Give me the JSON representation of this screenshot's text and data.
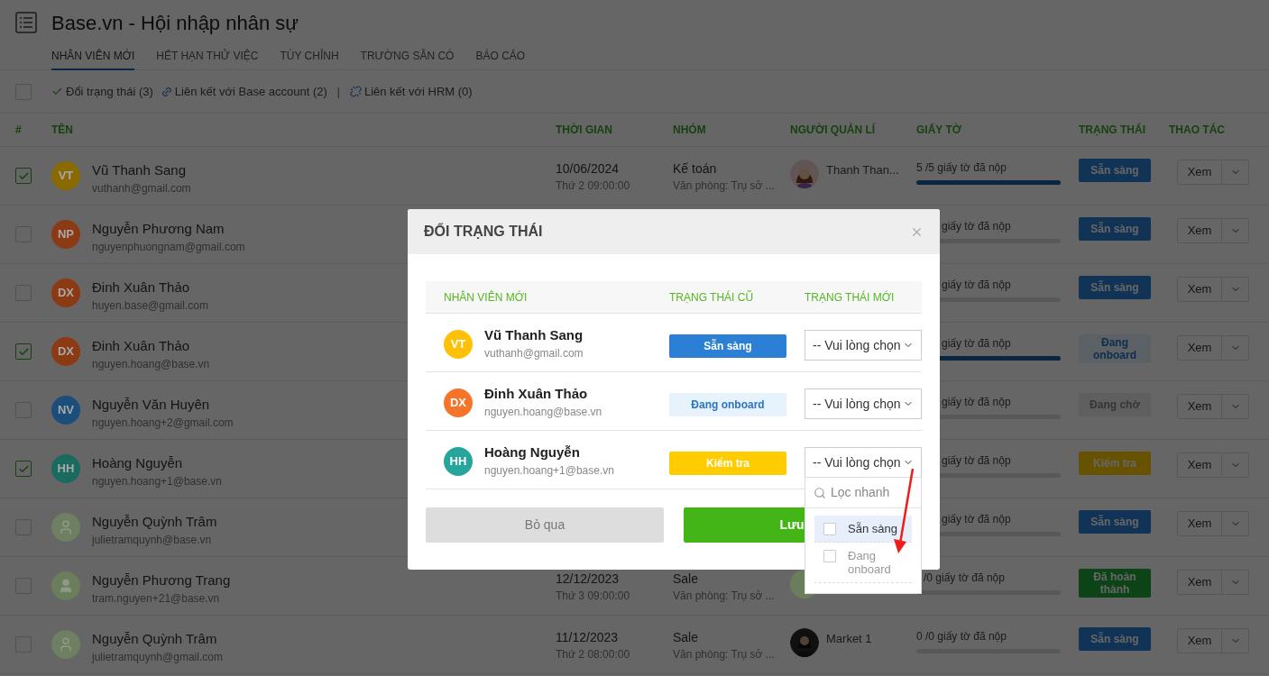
{
  "app": {
    "title": "Base.vn - Hội nhập nhân sự"
  },
  "tabs": [
    {
      "label": "NHÂN VIÊN MỚI",
      "selected": true
    },
    {
      "label": "HẾT HẠN THỬ VIỆC",
      "selected": false
    },
    {
      "label": "TÙY CHỈNH",
      "selected": false
    },
    {
      "label": "TRƯỜNG SẴN CÓ",
      "selected": false
    },
    {
      "label": "BÁO CÁO",
      "selected": false
    }
  ],
  "toolbar": {
    "select_all_checked": false,
    "actions": [
      {
        "kind": "check",
        "label": "Đổi trạng thái (3)"
      },
      {
        "kind": "link",
        "label": "Liên kết với Base account (2)"
      },
      {
        "kind": "separator",
        "label": "|"
      },
      {
        "kind": "unlink",
        "label": "Liên kết với HRM (0)"
      }
    ]
  },
  "table": {
    "columns": [
      "#",
      "TÊN",
      "THỜI GIAN",
      "NHÓM",
      "NGƯỜI QUẢN LÍ",
      "GIẤY TỜ",
      "TRẠNG THÁI",
      "THAO TÁC"
    ],
    "rows": [
      {
        "kind": "full",
        "checked": true,
        "avatar": {
          "kind": "initials",
          "initials": "VT",
          "color": "#8a6a00"
        },
        "name": "Vũ Thanh Sang",
        "email": "vuthanh@gmail.com",
        "date": "10/06/2024",
        "time": "Thứ 2 09:00:00",
        "group": "Kế toán",
        "office": "Văn phòng: Trụ sở ...",
        "manager": {
          "kind": "illustration",
          "name": "Thanh Than..."
        },
        "docs": "5 /5 giấy tờ đã nộp",
        "level": 1,
        "status": {
          "kind": "ready",
          "label": "Sẵn sàng"
        },
        "action": "Xem"
      },
      {
        "kind": "modal_covered",
        "checked": false,
        "avatar": {
          "kind": "initials",
          "initials": "NP",
          "color": "#8b3a14"
        },
        "name": "Nguyễn Phương Nam",
        "email": "nguyenphuongnam@gmail.com",
        "docs": "giấy tờ đã nộp",
        "level": 0,
        "status": {
          "kind": "ready",
          "label": "Sẵn sàng"
        },
        "action": "Xem"
      },
      {
        "kind": "modal_covered",
        "checked": false,
        "avatar": {
          "kind": "initials",
          "initials": "DX",
          "color": "#8b3a14"
        },
        "name": "Đinh Xuân Thảo",
        "email": "huyen.base@gmail.com",
        "docs": "giấy tờ đã nộp",
        "level": 0,
        "status": {
          "kind": "ready",
          "label": "Sẵn sàng"
        },
        "action": "Xem"
      },
      {
        "kind": "modal_covered",
        "checked": true,
        "avatar": {
          "kind": "initials",
          "initials": "DX",
          "color": "#8b3a14"
        },
        "name": "Đinh Xuân Thảo",
        "email": "nguyen.hoang@base.vn",
        "docs": "giấy tờ đã nộp",
        "level": 1,
        "status": {
          "kind": "onboarding",
          "label": "Đang onboard"
        },
        "action": "Xem"
      },
      {
        "kind": "modal_covered",
        "checked": false,
        "avatar": {
          "kind": "initials",
          "initials": "NV",
          "color": "#1b4e7a"
        },
        "name": "Nguyễn Văn Huyên",
        "email": "nguyen.hoang+2@gmail.com",
        "docs": "giấy tờ đã nộp",
        "level": 0,
        "status": {
          "kind": "waiting",
          "label": "Đang chờ"
        },
        "action": "Xem"
      },
      {
        "kind": "modal_covered",
        "checked": true,
        "avatar": {
          "kind": "initials",
          "initials": "HH",
          "color": "#1a6a5f"
        },
        "name": "Hoàng Nguyễn",
        "email": "nguyen.hoang+1@base.vn",
        "docs": "giấy tờ đã nộp",
        "level": 0,
        "status": {
          "kind": "checking",
          "label": "Kiểm tra"
        },
        "action": "Xem"
      },
      {
        "kind": "modal_covered",
        "checked": false,
        "avatar": {
          "kind": "outline",
          "color": "#6f7f62"
        },
        "name": "Nguyễn Quỳnh Trâm",
        "email": "julietramquynh@base.vn",
        "docs": "giấy tờ đã nộp",
        "level": 0,
        "status": {
          "kind": "ready",
          "label": "Sẵn sàng"
        },
        "action": "Xem"
      },
      {
        "kind": "dropdown_covered",
        "checked": false,
        "avatar": {
          "kind": "filled",
          "color": "#6a7e5c"
        },
        "name": "Nguyễn Phương Trang",
        "email": "tram.nguyen+21@base.vn",
        "date": "12/12/2023",
        "time": "Thứ 3 09:00:00",
        "group": "Sale",
        "office": "Văn phòng: Trụ sở ...",
        "manager": {
          "kind": "filled"
        },
        "docs": "/0 giấy tờ đã nộp",
        "level": 0,
        "status": {
          "kind": "done",
          "label": "Đã hoàn thành"
        },
        "action": "Xem"
      },
      {
        "kind": "full",
        "checked": false,
        "avatar": {
          "kind": "outline",
          "color": "#6f7f62"
        },
        "name": "Nguyễn Quỳnh Trâm",
        "email": "julietramquynh@gmail.com",
        "date": "11/12/2023",
        "time": "Thứ 2 08:00:00",
        "group": "Sale",
        "office": "Văn phòng: Trụ sở ...",
        "manager": {
          "name": "Market 1"
        },
        "docs": "0 /0 giấy tờ đã nộp",
        "level": 0,
        "status": {
          "kind": "ready",
          "label": "Sẵn sàng"
        },
        "action": "Xem"
      }
    ]
  },
  "dialog": {
    "title": "ĐỔI TRẠNG THÁI",
    "columns": [
      "NHÂN VIÊN MỚI",
      "TRẠNG THÁI CŨ",
      "TRẠNG THÁI MỚI"
    ],
    "rows": [
      {
        "avatar": {
          "initials": "VT",
          "color": "#ffc107"
        },
        "name": "Vũ Thanh Sang",
        "email": "vuthanh@gmail.com",
        "old_status": {
          "kind": "ready",
          "label": "Sẵn sàng"
        },
        "new_status": {
          "value": "-- Vui lòng chọn",
          "open": false
        }
      },
      {
        "avatar": {
          "initials": "DX",
          "color": "#f6732a"
        },
        "name": "Đinh Xuân Thảo",
        "email": "nguyen.hoang@base.vn",
        "old_status": {
          "kind": "onboarding",
          "label": "Đang onboard"
        },
        "new_status": {
          "value": "-- Vui lòng chọn",
          "open": false
        }
      },
      {
        "avatar": {
          "initials": "HH",
          "color": "#26a69a"
        },
        "name": "Hoàng Nguyễn",
        "email": "nguyen.hoang+1@base.vn",
        "old_status": {
          "kind": "checking",
          "label": "Kiểm tra"
        },
        "new_status": {
          "value": "-- Vui lòng chọn",
          "open": true,
          "search_placeholder": "Lọc nhanh",
          "options": [
            {
              "label": "Sẵn sàng",
              "checked": false,
              "highlighted": true,
              "disabled": false
            },
            {
              "label": "Đang onboard",
              "checked": false,
              "highlighted": false,
              "disabled": true
            }
          ]
        }
      }
    ],
    "buttons": [
      {
        "kind": "cancel",
        "label": "Bỏ qua"
      },
      {
        "kind": "save",
        "label": "Lưu"
      }
    ]
  }
}
